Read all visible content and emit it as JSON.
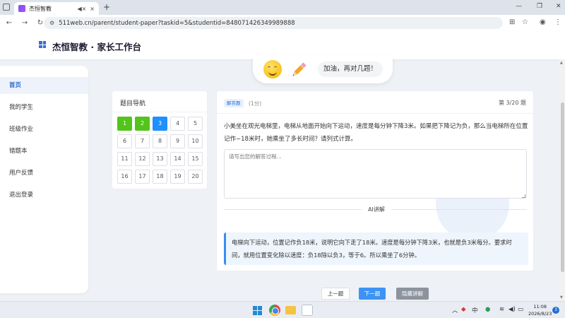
{
  "browser": {
    "tab_title": "杰恒智教",
    "tab_audio_icon": "speaker-muted-icon",
    "tab_close": "×",
    "new_tab": "+",
    "url": "511web.cn/parent/student-paper?taskid=5&studentid=848071426349989888"
  },
  "header": {
    "title": "杰恒智教 · 家长工作台"
  },
  "sidebar": {
    "items": [
      {
        "label": "首页",
        "active": true
      },
      {
        "label": "我的学生"
      },
      {
        "label": "班级作业"
      },
      {
        "label": "错题本"
      },
      {
        "label": "用户反馈"
      },
      {
        "label": "退出登录"
      }
    ]
  },
  "mascot": {
    "message": "加油，再对几题！"
  },
  "question_nav": {
    "title": "题目导航",
    "numbers": [
      "1",
      "2",
      "3",
      "4",
      "5",
      "6",
      "7",
      "8",
      "9",
      "10",
      "11",
      "12",
      "13",
      "14",
      "15",
      "16",
      "17",
      "18",
      "19",
      "20"
    ],
    "done": [
      1,
      2
    ],
    "current": 3
  },
  "question": {
    "type_badge": "解答题",
    "score": "(1分)",
    "progress": "第 3/20 题",
    "text": "小美坐在观光电梯里，电梯从地面开始向下运动，速度是每分钟下降3米。如果把下降记为负，那么当电梯所在位置记作−18米时，她乘坐了多长时间？请列式计算。",
    "answer_placeholder": "请写出您的解答过程...",
    "ai_label": "AI讲解",
    "explanation": "电梯向下运动，位置记作负18米，说明它向下走了18米。速度是每分钟下降3米，也就是负3米每分。要求时间，就用位置变化除以速度：负18除以负3，等于6。所以乘坐了6分钟。"
  },
  "buttons": {
    "prev": "上一题",
    "next": "下一题",
    "hide": "隐藏讲解"
  },
  "taskbar": {
    "ime": "中",
    "time": "11:08",
    "date": "2026/8/23",
    "notifications": "3"
  },
  "colors": {
    "primary": "#3c93f5",
    "done": "#52c41a",
    "current": "#1e90ff"
  }
}
